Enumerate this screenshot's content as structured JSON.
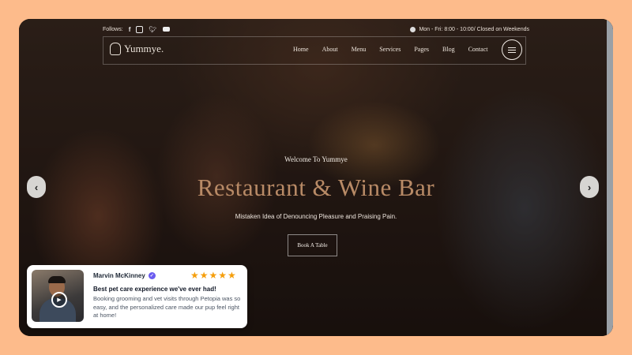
{
  "topbar": {
    "follow_label": "Follows:",
    "social_icons": [
      "facebook-icon",
      "instagram-icon",
      "twitter-icon",
      "youtube-icon"
    ],
    "hours": "Mon - Fri: 8:00 - 10:00/ Closed on Weekends"
  },
  "navbar": {
    "logo_text": "Yummye.",
    "menu": [
      "Home",
      "About",
      "Menu",
      "Services",
      "Pages",
      "Blog",
      "Contact"
    ]
  },
  "hero": {
    "welcome": "Welcome To Yummye",
    "title": "Restaurant & Wine Bar",
    "subtitle": "Mistaken Idea of Denouncing Pleasure and Praising Pain.",
    "cta": "Book A Table",
    "title_color": "#b88a66"
  },
  "review": {
    "name": "Marvin McKinney",
    "rating": 5,
    "stars": "★★★★★",
    "title": "Best pet care experience we've ever had!",
    "body": "Booking grooming and vet visits through Petopia was so easy, and the personalized care made our pup feel right at home!",
    "star_color": "#f59e0b",
    "badge_color": "#6b5cf0"
  },
  "background_color": "#FDBB8B"
}
